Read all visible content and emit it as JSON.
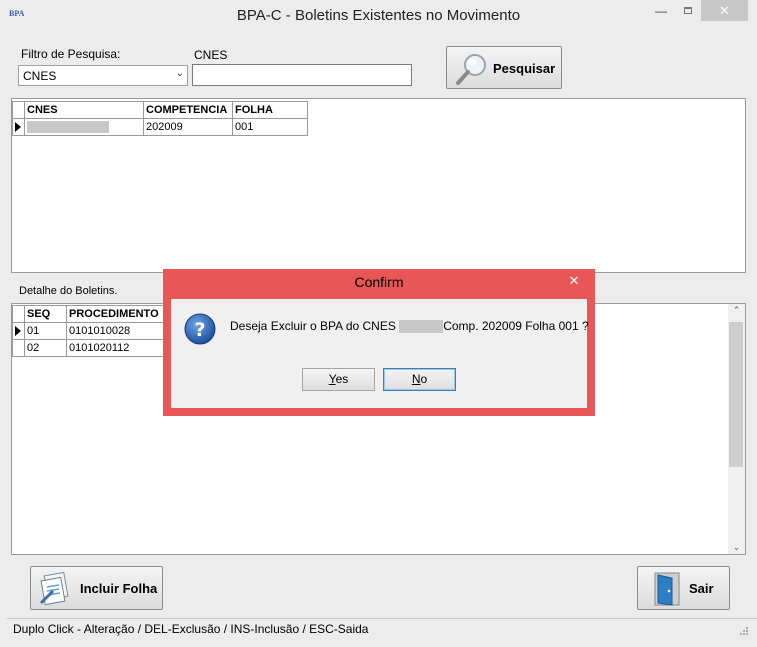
{
  "window": {
    "title": "BPA-C - Boletins Existentes no Movimento",
    "icon_text": "BPA",
    "minimize_glyph": "—",
    "close_glyph": "✕"
  },
  "filter": {
    "label": "Filtro de Pesquisa:",
    "selected": "CNES",
    "cnes_label": "CNES",
    "cnes_value": "",
    "search_button": "Pesquisar"
  },
  "grid1": {
    "headers": [
      "CNES",
      "COMPETENCIA",
      "FOLHA"
    ],
    "rows": [
      {
        "cnes": "",
        "competencia": "202009",
        "folha": "001"
      }
    ]
  },
  "detail": {
    "label": "Detalhe do Boletins.",
    "headers": [
      "SEQ",
      "PROCEDIMENTO"
    ],
    "rows": [
      {
        "seq": "01",
        "procedimento": "0101010028"
      },
      {
        "seq": "02",
        "procedimento": "0101020112"
      }
    ]
  },
  "buttons": {
    "incluir": "Incluir Folha",
    "sair": "Sair"
  },
  "status": {
    "text": "Duplo Click - Alteração  / DEL-Exclusão / INS-Inclusão / ESC-Saida"
  },
  "dialog": {
    "title": "Confirm",
    "close_glyph": "✕",
    "message_prefix": "Deseja Excluir o BPA do CNES",
    "message_suffix": "Comp. 202009 Folha 001 ?",
    "yes_rest": "es",
    "yes_underline": "Y",
    "no_underline": "N",
    "no_rest": "o"
  },
  "colors": {
    "dialog_border": "#e85656",
    "accent_focus": "#3c7fb1"
  }
}
